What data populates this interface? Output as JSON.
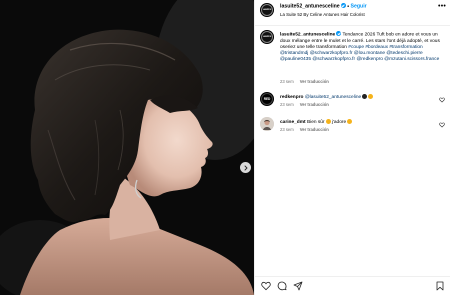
{
  "header": {
    "username": "lasuite52_antunesceline",
    "separator": "•",
    "follow_label": "Seguir",
    "subtitle": "La Suite 52 By Celine Antunes Hair Colorist",
    "avatar_text": "LA SUITE 52",
    "more_label": "•••"
  },
  "caption": {
    "username": "lasuite52_antunesceline",
    "text_1": "Tendance 2026 Tuft bob en adore et vous un doux mélange entre le mulet et le carré. Les stars l'ont déjà adopté, et vous oseriez une telle transformation",
    "tags": [
      "#coupe",
      "#bordeaux",
      "#transformation",
      "@tristandmdj",
      "@schwarzkopfpro.fr",
      "@lou.montane",
      "@tedeschi.pierre",
      "@pauline0435",
      "@schwarzkopfpro.fr",
      "@redkenpro",
      "@mzutani.scissors.france"
    ],
    "time": "23 sem",
    "see_translation": "Ver traducción"
  },
  "comments": [
    {
      "username": "redkenpro",
      "avatar_text": "RED",
      "mention": "@lasuite52_antunesceline",
      "text": "",
      "time": "23 sem",
      "see_translation": "Ver traducción"
    },
    {
      "username": "carine_dmt",
      "text": "Bien sûr",
      "text_2": "j'adore",
      "time": "23 sem",
      "see_translation": "Ver traducción"
    }
  ],
  "colors": {
    "accent_blue": "#0095f6",
    "link": "#00376b",
    "muted": "#737373",
    "border": "#efefef"
  },
  "icons": [
    "heart-icon",
    "comment-icon",
    "share-icon",
    "save-icon",
    "more-icon",
    "verified-icon",
    "chevron-right-icon"
  ]
}
